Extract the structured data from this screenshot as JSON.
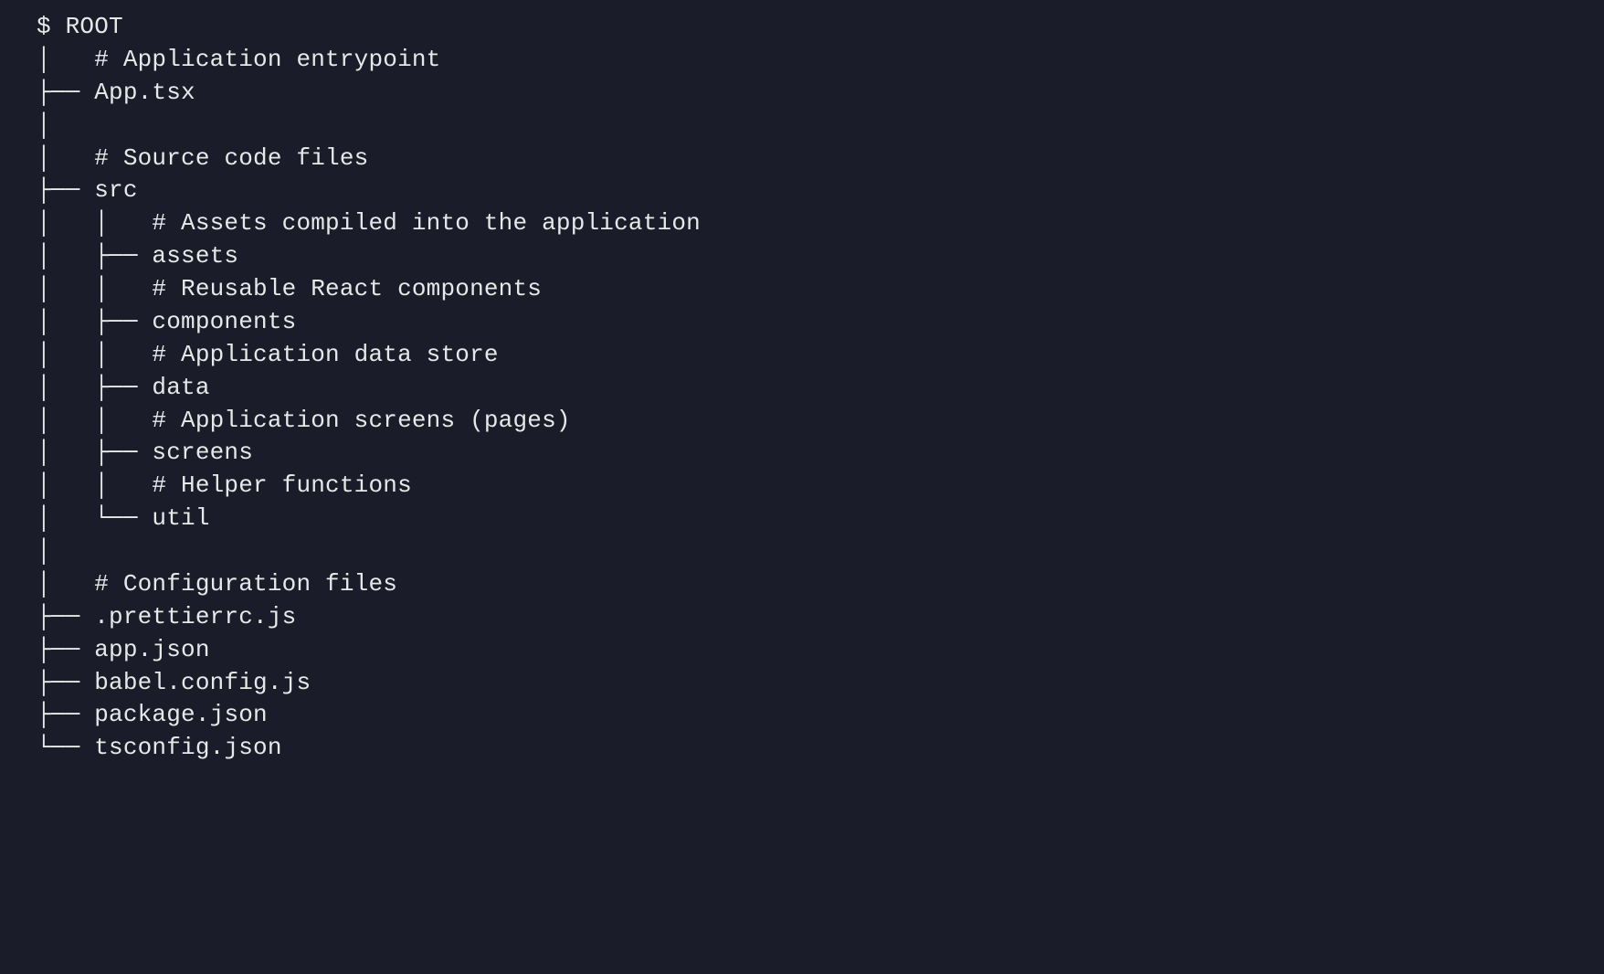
{
  "colors": {
    "background": "#1a1d29",
    "foreground": "#e8e8e8"
  },
  "tree": {
    "prompt": "$ ROOT",
    "lines": [
      {
        "prefix": "│   ",
        "text": "# Application entrypoint"
      },
      {
        "prefix": "├── ",
        "text": "App.tsx"
      },
      {
        "prefix": "│",
        "text": ""
      },
      {
        "prefix": "│   ",
        "text": "# Source code files"
      },
      {
        "prefix": "├── ",
        "text": "src"
      },
      {
        "prefix": "│   │   ",
        "text": "# Assets compiled into the application"
      },
      {
        "prefix": "│   ├── ",
        "text": "assets"
      },
      {
        "prefix": "│   │   ",
        "text": "# Reusable React components"
      },
      {
        "prefix": "│   ├── ",
        "text": "components"
      },
      {
        "prefix": "│   │   ",
        "text": "# Application data store"
      },
      {
        "prefix": "│   ├── ",
        "text": "data"
      },
      {
        "prefix": "│   │   ",
        "text": "# Application screens (pages)"
      },
      {
        "prefix": "│   ├── ",
        "text": "screens"
      },
      {
        "prefix": "│   │   ",
        "text": "# Helper functions"
      },
      {
        "prefix": "│   └── ",
        "text": "util"
      },
      {
        "prefix": "│",
        "text": ""
      },
      {
        "prefix": "│   ",
        "text": "# Configuration files"
      },
      {
        "prefix": "├── ",
        "text": ".prettierrc.js"
      },
      {
        "prefix": "├── ",
        "text": "app.json"
      },
      {
        "prefix": "├── ",
        "text": "babel.config.js"
      },
      {
        "prefix": "├── ",
        "text": "package.json"
      },
      {
        "prefix": "└── ",
        "text": "tsconfig.json"
      }
    ]
  }
}
